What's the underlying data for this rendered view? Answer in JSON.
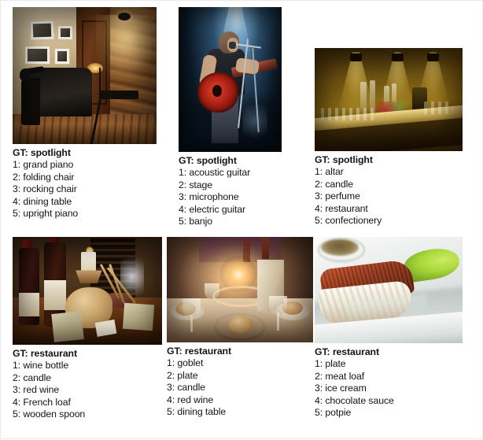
{
  "figure": {
    "title": "Qualitative results grid",
    "rows": 2,
    "columns": 3
  },
  "cells": [
    {
      "id": "cell-1",
      "image_name": "dark-room-with-chairs-and-piano",
      "image_alt": "Dimly lit room with a dark sofa, folding director's chair, framed pictures and a spotlight on a stone wall",
      "gt": "GT: spotlight",
      "predictions": [
        "1: grand piano",
        "2: folding chair",
        "3: rocking chair",
        "4: dining table",
        "5: upright piano"
      ]
    },
    {
      "id": "cell-2",
      "image_name": "guitarist-on-stage",
      "image_alt": "Musician playing a red acoustic guitar on stage under a blue spotlight with microphones",
      "gt": "GT: spotlight",
      "predictions": [
        "1: acoustic guitar",
        "2: stage",
        "3: microphone",
        "4: electric guitar",
        "5: banjo"
      ]
    },
    {
      "id": "cell-3",
      "image_name": "golden-lit-bar-counter",
      "image_alt": "Bar counter lit by warm golden track spotlights with glassware, vases and fruit arrangement",
      "gt": "GT: spotlight",
      "predictions": [
        "1: altar",
        "2: candle",
        "3: perfume",
        "4: restaurant",
        "5: confectionery"
      ]
    },
    {
      "id": "cell-4",
      "image_name": "wine-bread-and-cheese-table",
      "image_alt": "Two wine bottles, a lit candle, a round bread loaf, breadsticks and cheese on a wooden table",
      "gt": "GT: restaurant",
      "predictions": [
        "1: wine bottle",
        "2: candle",
        "3: red wine",
        "4: French loaf",
        "5: wooden spoon"
      ]
    },
    {
      "id": "cell-5",
      "image_name": "candlelit-banquet-table",
      "image_alt": "Banquet table at night with a glowing candle globe, goblets, plates and bread rolls",
      "gt": "GT: restaurant",
      "predictions": [
        "1: goblet",
        "2: plate",
        "3: candle",
        "4: red wine",
        "5: dining table"
      ]
    },
    {
      "id": "cell-6",
      "image_name": "plated-fish-with-green-sauce",
      "image_alt": "Crisp-skinned fish fillet on a white plate with a swoosh of bright green sauce",
      "gt": "GT: restaurant",
      "predictions": [
        "1: plate",
        "2: meat loaf",
        "3: ice cream",
        "4: chocolate sauce",
        "5: potpie"
      ]
    }
  ],
  "colors": {
    "page_background": "#ffffff",
    "text": "#141414",
    "border": "#e9e9e9"
  }
}
